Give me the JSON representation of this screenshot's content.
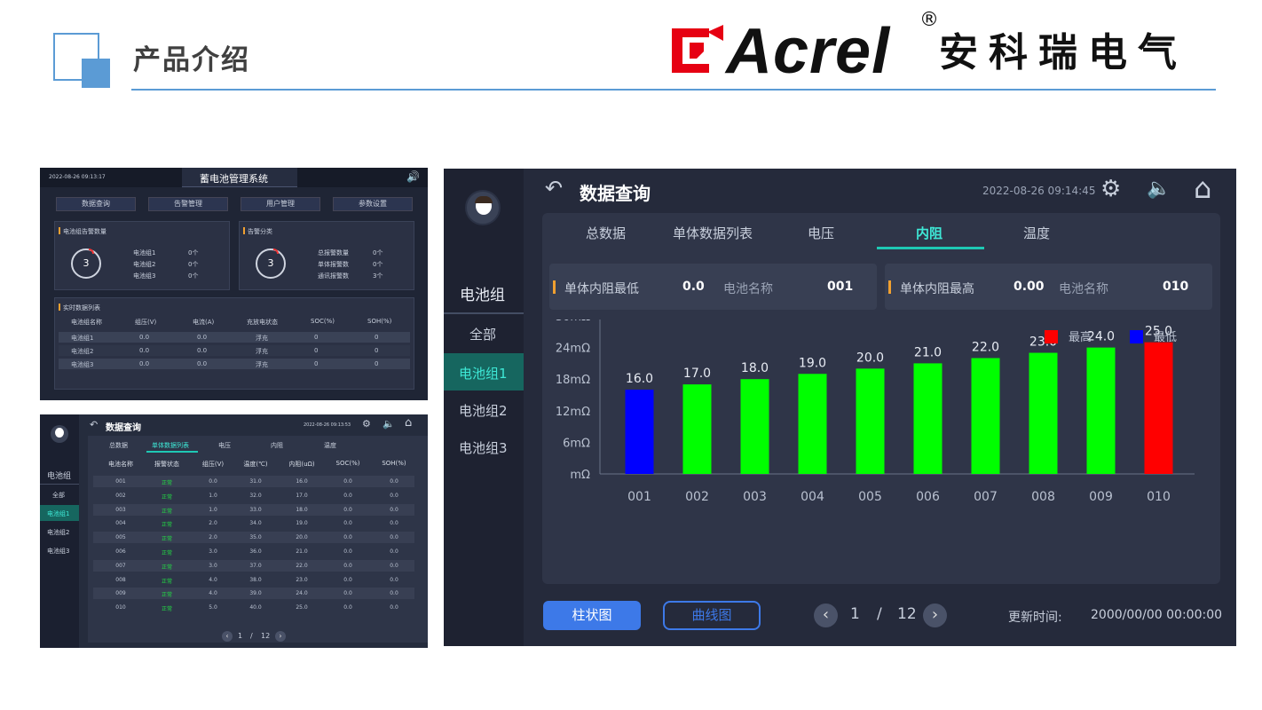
{
  "header": {
    "title": "产品介绍",
    "brand": "Acrel",
    "brand_reg": "®",
    "brand_cn": "安科瑞电气"
  },
  "panel1": {
    "timestamp": "2022-08-26 09:13:17",
    "title": "蓄电池管理系统",
    "buttons": [
      "数据查询",
      "告警管理",
      "用户管理",
      "参数设置"
    ],
    "box1": {
      "title": "电池组告警数量",
      "gauge": "3",
      "items": [
        [
          "电池组1",
          "0个"
        ],
        [
          "电池组2",
          "0个"
        ],
        [
          "电池组3",
          "0个"
        ]
      ]
    },
    "box2": {
      "title": "告警分类",
      "gauge": "3",
      "items": [
        [
          "总报警数量",
          "0个"
        ],
        [
          "单体报警数",
          "0个"
        ],
        [
          "通讯报警数",
          "3个"
        ]
      ]
    },
    "table": {
      "title": "实时数据列表",
      "headers": [
        "电池组名称",
        "组压(V)",
        "电流(A)",
        "充放电状态",
        "SOC(%)",
        "SOH(%)"
      ],
      "rows": [
        [
          "电池组1",
          "0.0",
          "0.0",
          "浮充",
          "0",
          "0"
        ],
        [
          "电池组2",
          "0.0",
          "0.0",
          "浮充",
          "0",
          "0"
        ],
        [
          "电池组3",
          "0.0",
          "0.0",
          "浮充",
          "0",
          "0"
        ]
      ]
    }
  },
  "panel2": {
    "title": "数据查询",
    "timestamp": "2022-08-26 09:13:53",
    "tabs": [
      "总数据",
      "单体数据列表",
      "电压",
      "内阻",
      "温度"
    ],
    "side": {
      "title": "电池组",
      "items": [
        "全部",
        "电池组1",
        "电池组2",
        "电池组3"
      ]
    },
    "headers": [
      "电池名称",
      "报警状态",
      "组压(V)",
      "温度(℃)",
      "内阻(uΩ)",
      "SOC(%)",
      "SOH(%)"
    ],
    "rows": [
      [
        "001",
        "正常",
        "0.0",
        "31.0",
        "16.0",
        "0.0",
        "0.0"
      ],
      [
        "002",
        "正常",
        "1.0",
        "32.0",
        "17.0",
        "0.0",
        "0.0"
      ],
      [
        "003",
        "正常",
        "1.0",
        "33.0",
        "18.0",
        "0.0",
        "0.0"
      ],
      [
        "004",
        "正常",
        "2.0",
        "34.0",
        "19.0",
        "0.0",
        "0.0"
      ],
      [
        "005",
        "正常",
        "2.0",
        "35.0",
        "20.0",
        "0.0",
        "0.0"
      ],
      [
        "006",
        "正常",
        "3.0",
        "36.0",
        "21.0",
        "0.0",
        "0.0"
      ],
      [
        "007",
        "正常",
        "3.0",
        "37.0",
        "22.0",
        "0.0",
        "0.0"
      ],
      [
        "008",
        "正常",
        "4.0",
        "38.0",
        "23.0",
        "0.0",
        "0.0"
      ],
      [
        "009",
        "正常",
        "4.0",
        "39.0",
        "24.0",
        "0.0",
        "0.0"
      ],
      [
        "010",
        "正常",
        "5.0",
        "40.0",
        "25.0",
        "0.0",
        "0.0"
      ]
    ],
    "pager": {
      "page": "1",
      "sep": "/",
      "total": "12"
    }
  },
  "panel3": {
    "title": "数据查询",
    "timestamp": "2022-08-26 09:14:45",
    "tabs": [
      "总数据",
      "单体数据列表",
      "电压",
      "内阻",
      "温度"
    ],
    "active_tab": 3,
    "side": {
      "title": "电池组",
      "items": [
        "全部",
        "电池组1",
        "电池组2",
        "电池组3"
      ],
      "active": 1
    },
    "stat_min": {
      "label": "单体内阻最低",
      "value": "0.0",
      "name_label": "电池名称",
      "name": "001"
    },
    "stat_max": {
      "label": "单体内阻最高",
      "value": "0.00",
      "name_label": "电池名称",
      "name": "010"
    },
    "buttons": {
      "bar": "柱状图",
      "line": "曲线图"
    },
    "pager": {
      "page": "1",
      "sep": "/",
      "total": "12"
    },
    "update": {
      "label": "更新时间:",
      "value": "2000/00/00 00:00:00"
    }
  },
  "colors": {
    "accent": "#1ec8b4",
    "highest": "#ff0000",
    "lowest": "#0000ff",
    "normal": "#00ff00",
    "ok": "#22dd44"
  },
  "chart_data": {
    "type": "bar",
    "categories": [
      "001",
      "002",
      "003",
      "004",
      "005",
      "006",
      "007",
      "008",
      "009",
      "010"
    ],
    "values": [
      16.0,
      17.0,
      18.0,
      19.0,
      20.0,
      21.0,
      22.0,
      23.0,
      24.0,
      25.0
    ],
    "data_labels": [
      "16.0",
      "17.0",
      "18.0",
      "19.0",
      "20.0",
      "21.0",
      "22.0",
      "23.0",
      "24.0",
      "25.0"
    ],
    "bar_colors": [
      "#0000ff",
      "#00ff00",
      "#00ff00",
      "#00ff00",
      "#00ff00",
      "#00ff00",
      "#00ff00",
      "#00ff00",
      "#00ff00",
      "#ff0000"
    ],
    "yticks": [
      "mΩ",
      "6mΩ",
      "12mΩ",
      "18mΩ",
      "24mΩ",
      "30mΩ"
    ],
    "ylim": [
      0,
      30
    ],
    "legend": [
      {
        "name": "最高",
        "color": "#ff0000"
      },
      {
        "name": "最低",
        "color": "#0000ff"
      }
    ],
    "legend_position": "top-right",
    "grid": false
  }
}
